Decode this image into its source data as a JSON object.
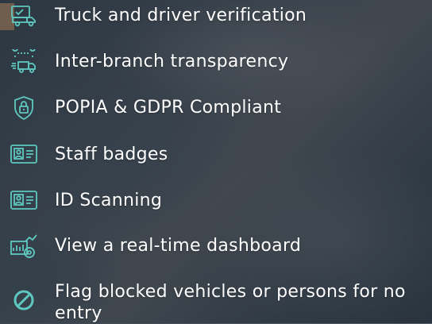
{
  "features": [
    {
      "label": "Truck and driver verification",
      "icon": "truck-verify-icon"
    },
    {
      "label": "Inter-branch transparency",
      "icon": "route-truck-icon"
    },
    {
      "label": "POPIA & GDPR Compliant",
      "icon": "shield-lock-icon"
    },
    {
      "label": "Staff badges",
      "icon": "id-badge-icon"
    },
    {
      "label": "ID Scanning",
      "icon": "id-card-icon"
    },
    {
      "label": "View a real-time dashboard",
      "icon": "dashboard-chart-icon"
    },
    {
      "label": "Flag blocked vehicles or persons for no entry",
      "icon": "blocked-icon"
    }
  ],
  "colors": {
    "icon": "#5ec8c0",
    "text": "#ffffff"
  }
}
